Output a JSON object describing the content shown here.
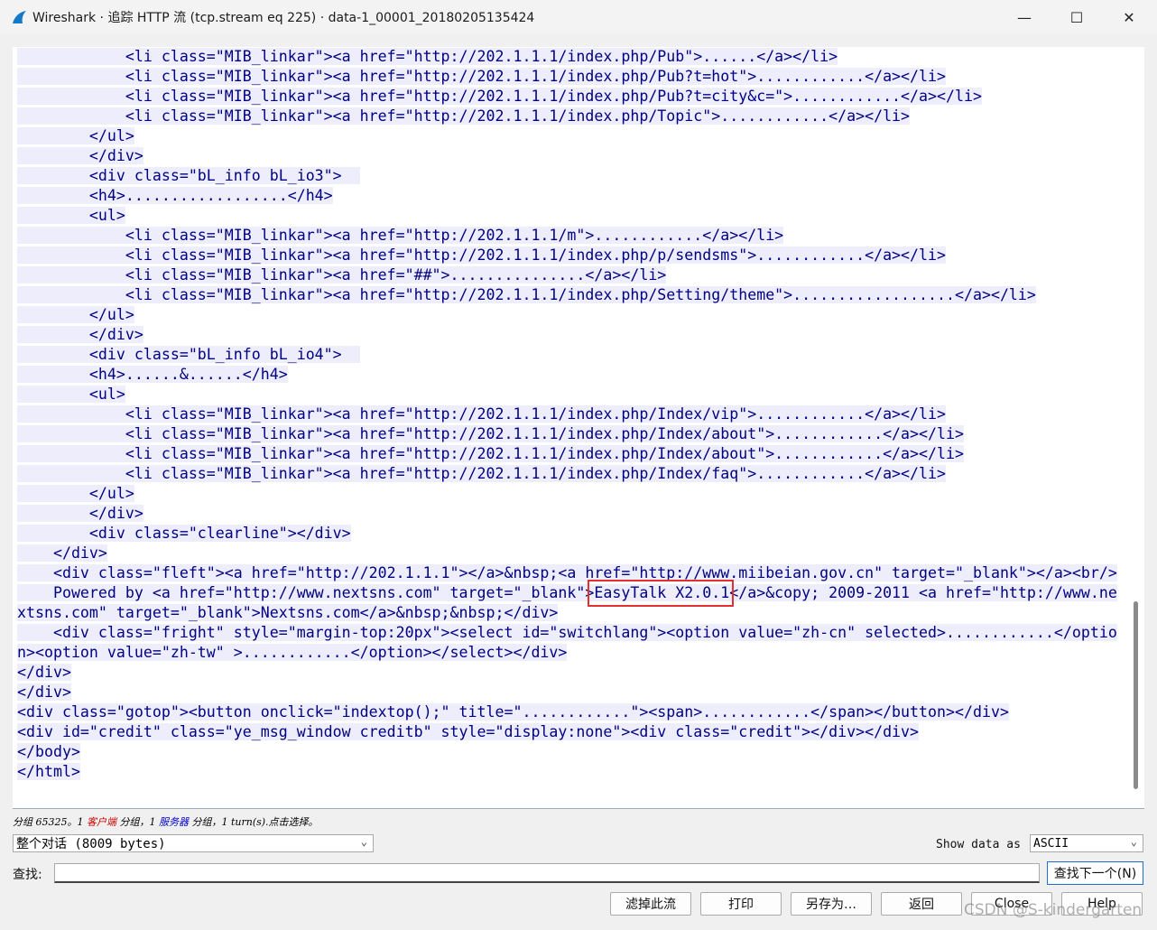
{
  "window": {
    "title": "Wireshark · 追踪 HTTP 流 (tcp.stream eq 225) · data-1_00001_20180205135424",
    "minimize": "—",
    "maximize": "☐",
    "close": "✕"
  },
  "stream": {
    "lines": [
      "            <li class=\"MIB_linkar\"><a href=\"http://202.1.1.1/index.php/Pub\">......</a></li>",
      "            <li class=\"MIB_linkar\"><a href=\"http://202.1.1.1/index.php/Pub?t=hot\">............</a></li>",
      "            <li class=\"MIB_linkar\"><a href=\"http://202.1.1.1/index.php/Pub?t=city&c=\">............</a></li>",
      "            <li class=\"MIB_linkar\"><a href=\"http://202.1.1.1/index.php/Topic\">............</a></li>",
      "        </ul>",
      "        </div>",
      "        <div class=\"bL_info bL_io3\">  ",
      "        <h4>..................</h4>",
      "        <ul>",
      "            <li class=\"MIB_linkar\"><a href=\"http://202.1.1.1/m\">............</a></li>",
      "            <li class=\"MIB_linkar\"><a href=\"http://202.1.1.1/index.php/p/sendsms\">............</a></li>",
      "            <li class=\"MIB_linkar\"><a href=\"##\">...............</a></li>",
      "            <li class=\"MIB_linkar\"><a href=\"http://202.1.1.1/index.php/Setting/theme\">..................</a></li>",
      "        </ul>",
      "        </div>",
      "        <div class=\"bL_info bL_io4\">  ",
      "        <h4>......&......</h4>",
      "        <ul>",
      "            <li class=\"MIB_linkar\"><a href=\"http://202.1.1.1/index.php/Index/vip\">............</a></li>",
      "            <li class=\"MIB_linkar\"><a href=\"http://202.1.1.1/index.php/Index/about\">............</a></li>",
      "            <li class=\"MIB_linkar\"><a href=\"http://202.1.1.1/index.php/Index/about\">............</a></li>",
      "            <li class=\"MIB_linkar\"><a href=\"http://202.1.1.1/index.php/Index/faq\">............</a></li>",
      "        </ul>",
      "        </div>",
      "        <div class=\"clearline\"></div>",
      "    </div>",
      "    <div class=\"fleft\"><a href=\"http://202.1.1.1\"></a>&nbsp;<a href=\"http://www.miibeian.gov.cn\" target=\"_blank\"></a><br/>",
      "    Powered by <a href=\"http://www.nextsns.com\" target=\"_blank\">EasyTalk X2.0.1</a>&copy; 2009-2011 <a href=\"http://www.ne",
      "xtsns.com\" target=\"_blank\">Nextsns.com</a>&nbsp;&nbsp;</div>",
      "    <div class=\"fright\" style=\"margin-top:20px\"><select id=\"switchlang\"><option value=\"zh-cn\" selected>............</optio",
      "n><option value=\"zh-tw\" >............</option></select></div>",
      "</div>",
      "</div>",
      "<div class=\"gotop\"><button onclick=\"indextop();\" title=\"............\"><span>............</span></button></div>",
      "<div id=\"credit\" class=\"ye_msg_window creditb\" style=\"display:none\"><div class=\"credit\"></div></div>",
      "</body>",
      "</html>"
    ]
  },
  "status": {
    "prefix": "分组 65325。1 ",
    "client": "客户端",
    "mid1": " 分组，1 ",
    "server": "服务器",
    "suffix": " 分组，1 turn(s).点击选择。"
  },
  "controls": {
    "conversation": "整个对话 (8009 bytes)",
    "show_data_label": "Show data as",
    "show_data_value": "ASCII",
    "find_label": "查找:",
    "find_value": "",
    "find_next": "查找下一个(N)"
  },
  "buttons": {
    "filter_out": "滤掉此流",
    "print": "打印",
    "save_as": "另存为…",
    "back": "返回",
    "close": "Close",
    "help": "Help"
  },
  "watermark": "CSDN @S-kindergarten"
}
